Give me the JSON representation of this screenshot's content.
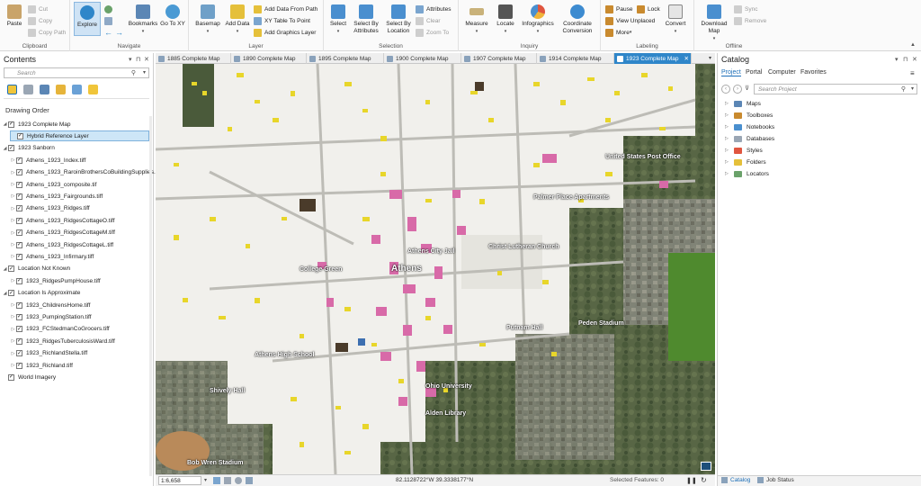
{
  "ribbon": {
    "clipboard": {
      "label": "Clipboard",
      "paste": "Paste",
      "cut": "Cut",
      "copy": "Copy",
      "copy_path": "Copy Path"
    },
    "navigate": {
      "label": "Navigate",
      "explore": "Explore",
      "bookmarks": "Bookmarks",
      "go_to_xy": "Go To XY"
    },
    "layer": {
      "label": "Layer",
      "basemap": "Basemap",
      "add_data": "Add Data",
      "add_data_from_path": "Add Data From Path",
      "xy_table_to_point": "XY Table To Point",
      "add_graphics_layer": "Add Graphics Layer"
    },
    "selection": {
      "label": "Selection",
      "select": "Select",
      "select_by_attributes": "Select By Attributes",
      "select_by_location": "Select By Location",
      "attributes": "Attributes",
      "clear": "Clear",
      "zoom_to": "Zoom To"
    },
    "inquiry": {
      "label": "Inquiry",
      "measure": "Measure",
      "locate": "Locate",
      "infographics": "Infographics",
      "coordinate_conversion": "Coordinate Conversion"
    },
    "labeling": {
      "label": "Labeling",
      "pause": "Pause",
      "lock": "Lock",
      "view_unplaced": "View Unplaced",
      "more": "More",
      "convert": "Convert"
    },
    "offline": {
      "label": "Offline",
      "download_map": "Download Map",
      "sync": "Sync",
      "remove": "Remove"
    }
  },
  "contents": {
    "title": "Contents",
    "search_placeholder": "Search",
    "drawing_order": "Drawing Order",
    "layers": [
      {
        "label": "1923 Complete Map",
        "level": 0,
        "checked": true,
        "expand": "open"
      },
      {
        "label": "Hybrid Reference Layer",
        "level": 1,
        "checked": true,
        "expand": "none",
        "selected": true
      },
      {
        "label": "1923 Sanborn",
        "level": 0,
        "checked": true,
        "expand": "open"
      },
      {
        "label": "Athens_1923_Index.tiff",
        "level": 1,
        "checked": true,
        "expand": "closed"
      },
      {
        "label": "Athens_1923_RaroinBrothersCoBuildingSupplies.tiff",
        "level": 1,
        "checked": true,
        "expand": "closed"
      },
      {
        "label": "Athens_1923_composite.tif",
        "level": 1,
        "checked": true,
        "expand": "closed"
      },
      {
        "label": "Athens_1923_Fairgrounds.tiff",
        "level": 1,
        "checked": true,
        "expand": "closed"
      },
      {
        "label": "Athens_1923_Ridges.tiff",
        "level": 1,
        "checked": true,
        "expand": "closed"
      },
      {
        "label": "Athens_1923_RidgesCottageO.tiff",
        "level": 1,
        "checked": true,
        "expand": "closed"
      },
      {
        "label": "Athens_1923_RidgesCottageM.tiff",
        "level": 1,
        "checked": true,
        "expand": "closed"
      },
      {
        "label": "Athens_1923_RidgesCottageL.tiff",
        "level": 1,
        "checked": true,
        "expand": "closed"
      },
      {
        "label": "Athens_1923_Infirmary.tiff",
        "level": 1,
        "checked": true,
        "expand": "closed"
      },
      {
        "label": "Location Not Known",
        "level": 0,
        "checked": true,
        "expand": "open"
      },
      {
        "label": "1923_RidgesPumpHouse.tiff",
        "level": 1,
        "checked": true,
        "expand": "closed"
      },
      {
        "label": "Location Is Approximate",
        "level": 0,
        "checked": true,
        "expand": "open"
      },
      {
        "label": "1923_ChildrensHome.tiff",
        "level": 1,
        "checked": true,
        "expand": "closed"
      },
      {
        "label": "1923_PumpingStation.tiff",
        "level": 1,
        "checked": true,
        "expand": "closed"
      },
      {
        "label": "1923_FCStedmanCoGrocers.tiff",
        "level": 1,
        "checked": true,
        "expand": "closed"
      },
      {
        "label": "1923_RidgesTuberculosisWard.tiff",
        "level": 1,
        "checked": true,
        "expand": "closed"
      },
      {
        "label": "1923_RichlandStella.tiff",
        "level": 1,
        "checked": true,
        "expand": "closed"
      },
      {
        "label": "1923_Richland.tiff",
        "level": 1,
        "checked": true,
        "expand": "closed"
      },
      {
        "label": "World Imagery",
        "level": 0,
        "checked": true,
        "expand": "none"
      }
    ]
  },
  "tabs": [
    "1885 Complete Map",
    "1890 Complete Map",
    "1895 Complete Map",
    "1900 Complete Map",
    "1907 Complete Map",
    "1914 Complete Map",
    "1923 Complete Map"
  ],
  "active_tab": "1923 Complete Map",
  "map": {
    "labels": [
      "Athens",
      "Alden Library",
      "Athens City Jail",
      "Ohio University",
      "Palmer Place Apartments",
      "United States Post Office",
      "College Green",
      "Christ Lutheran Church",
      "Peden Stadium",
      "Athens High School",
      "Bob Wren Stadium",
      "Putnam Hall",
      "Shively Hall"
    ]
  },
  "status": {
    "scale": "1:6,658",
    "coordinates": "82.1128722°W 39.3338177°N",
    "selected_features": "Selected Features: 0"
  },
  "catalog": {
    "title": "Catalog",
    "tabs": [
      "Project",
      "Portal",
      "Computer",
      "Favorites"
    ],
    "search_placeholder": "Search Project",
    "items": [
      "Maps",
      "Toolboxes",
      "Notebooks",
      "Databases",
      "Styles",
      "Folders",
      "Locators"
    ],
    "bottom_tabs": [
      "Catalog",
      "Job Status"
    ]
  },
  "colors": {
    "accent": "#2f86c9",
    "sanborn_yellow": "#e8d62a",
    "sanborn_pink": "#d86aa8"
  }
}
